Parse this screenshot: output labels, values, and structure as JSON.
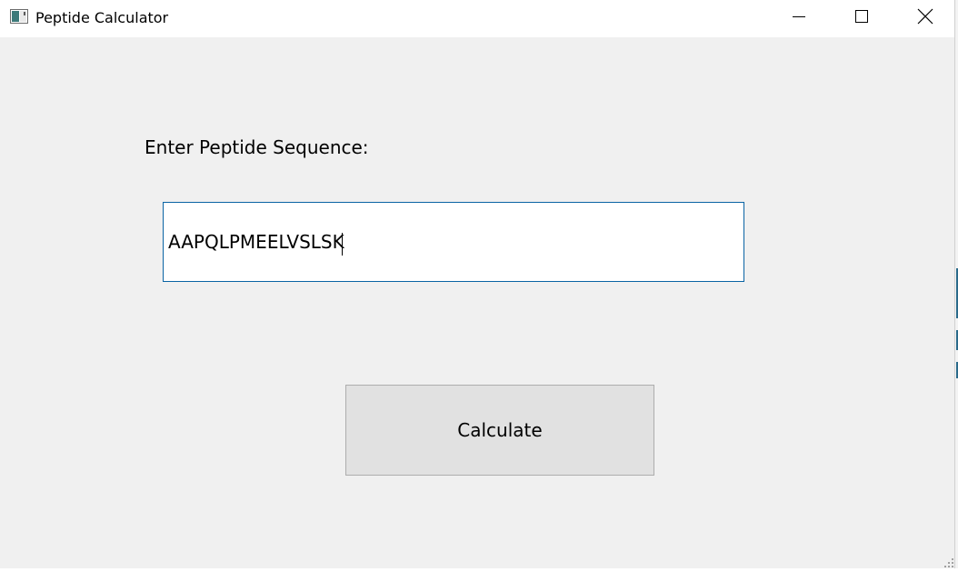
{
  "window": {
    "title": "Peptide Calculator",
    "icon": "app-window-icon",
    "controls": {
      "minimize_icon": "minimize-icon",
      "maximize_icon": "maximize-icon",
      "close_icon": "close-icon"
    }
  },
  "form": {
    "label": "Enter Peptide Sequence:",
    "sequence_value": "AAPQLPMEELVSLSK",
    "button_label": "Calculate"
  },
  "colors": {
    "window_bg": "#f0f0f0",
    "titlebar_bg": "#ffffff",
    "input_border": "#0a64a4",
    "button_bg": "#e1e1e1",
    "button_border": "#adadad"
  }
}
